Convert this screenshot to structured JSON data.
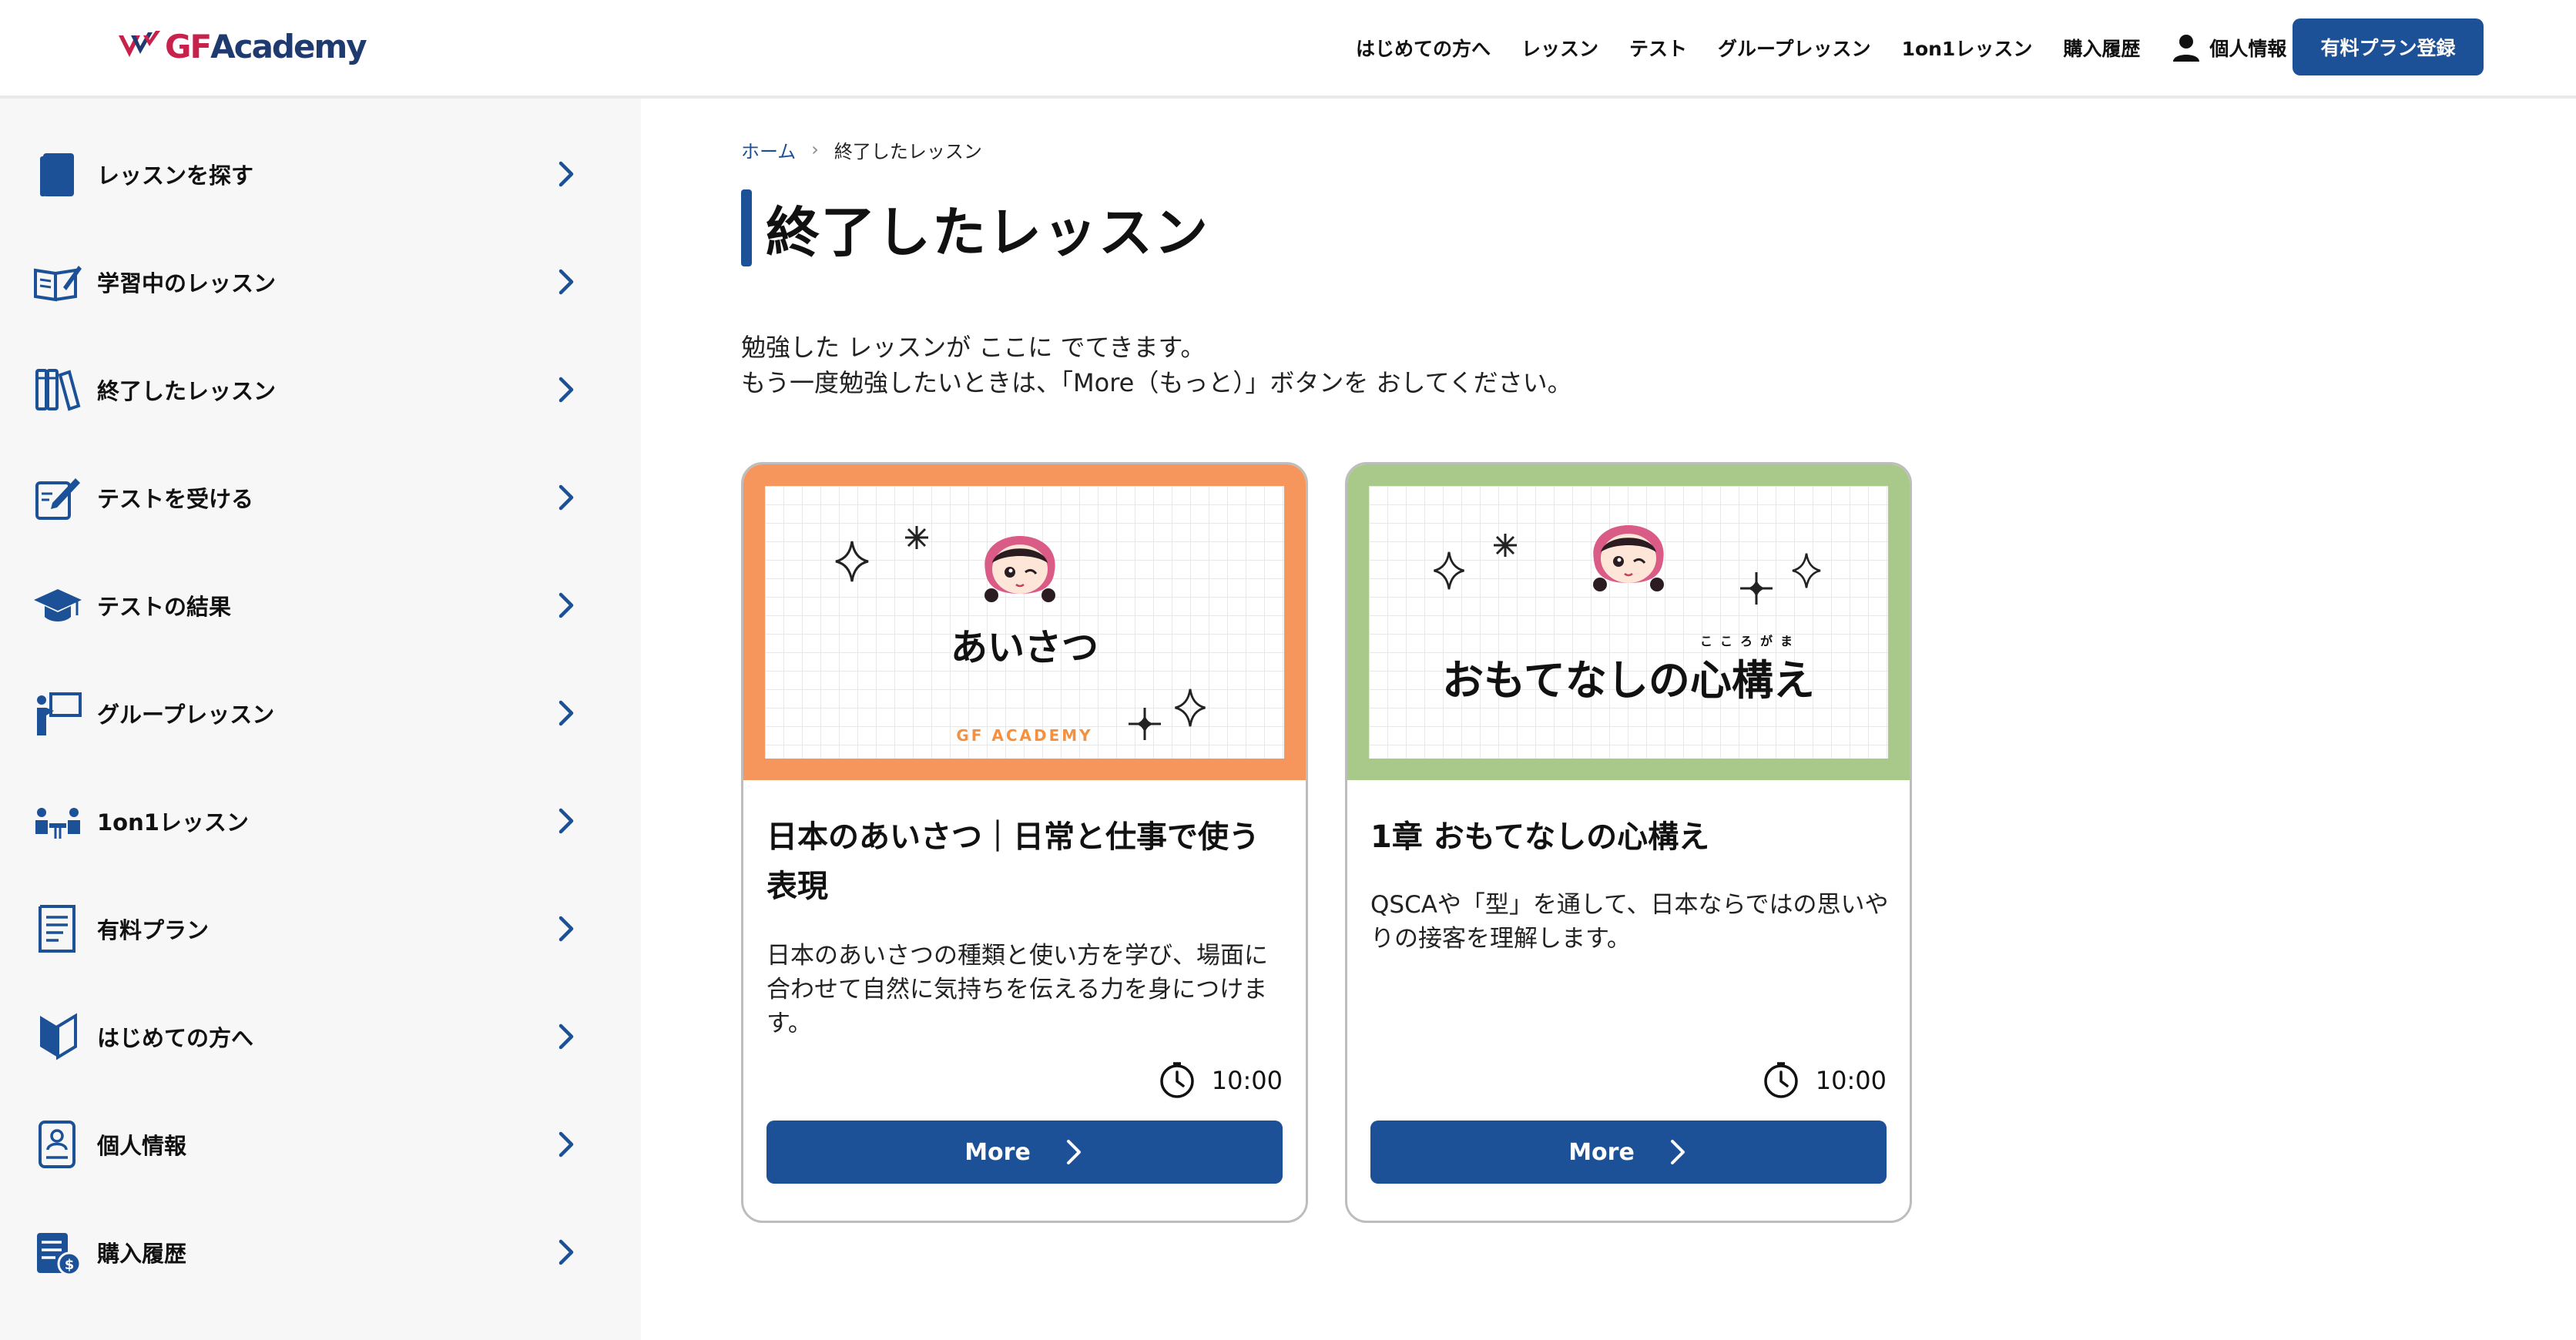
{
  "header": {
    "logo": "GF Academy",
    "nav": [
      "はじめての方へ",
      "レッスン",
      "テスト",
      "グループレッスン",
      "1on1レッスン",
      "購入履歴"
    ],
    "account_label": "個人情報",
    "cta_label": "有料プラン登録"
  },
  "sidebar": {
    "items": [
      {
        "label": "レッスンを探す",
        "icon": "book-icon"
      },
      {
        "label": "学習中のレッスン",
        "icon": "open-book-pen-icon"
      },
      {
        "label": "終了したレッスン",
        "icon": "books-icon"
      },
      {
        "label": "テストを受ける",
        "icon": "test-edit-icon"
      },
      {
        "label": "テストの結果",
        "icon": "graduation-cap-icon"
      },
      {
        "label": "グループレッスン",
        "icon": "presentation-icon"
      },
      {
        "label": "1on1レッスン",
        "icon": "meeting-icon"
      },
      {
        "label": "有料プラン",
        "icon": "receipt-icon"
      },
      {
        "label": "はじめての方へ",
        "icon": "beginner-mark-icon"
      },
      {
        "label": "個人情報",
        "icon": "profile-doc-icon"
      },
      {
        "label": "購入履歴",
        "icon": "purchase-history-icon"
      }
    ]
  },
  "breadcrumb": {
    "home": "ホーム",
    "separator": "›",
    "current": "終了したレッスン"
  },
  "page": {
    "title": "終了したレッスン",
    "intro_line1": "勉強した レッスンが ここに でてきます。",
    "intro_line2": "もう一度勉強したいときは、「More（もっと）」ボタンを おしてください。"
  },
  "cards": [
    {
      "thumb_title": "あいさつ",
      "thumb_brand": "GF ACADEMY",
      "thumb_color": "#f7965c",
      "title": "日本のあいさつ｜日常と仕事で使う表現",
      "description": "日本のあいさつの種類と使い方を学び、場面に合わせて自然に気持ちを伝える力を身につけます。",
      "duration": "10:00",
      "button": "More"
    },
    {
      "thumb_title": "おもてなしの心構え",
      "thumb_ruby": "こころがま",
      "thumb_color": "#a9c98a",
      "title": "1章 おもてなしの心構え",
      "description": "QSCAや「型」を通して、日本ならではの思いやりの接客を理解します。",
      "duration": "10:00",
      "button": "More"
    }
  ],
  "colors": {
    "primary": "#1c5197",
    "sidebar_bg": "#f7f7f7",
    "logo_red": "#c6224c",
    "logo_navy": "#1f3a6e"
  }
}
